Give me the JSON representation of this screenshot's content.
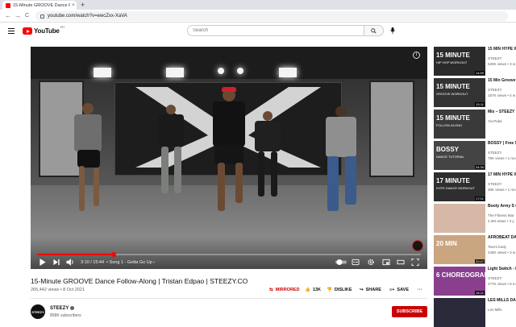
{
  "browser": {
    "tab_title": "15-Minute GROOVE Dance Follo...",
    "tab_close": "×",
    "new_tab": "+",
    "url": "youtube.com/watch?v=ewcZxx-XaVA",
    "back": "←",
    "forward": "→",
    "reload": "C"
  },
  "header": {
    "logo_text": "YouTube",
    "logo_sup": "PH",
    "search_placeholder": "Search"
  },
  "player": {
    "time": "3:10 / 15:44",
    "chapter": "• Song 1 - Gotta Go Up  ›",
    "progress": 0.2
  },
  "video": {
    "title": "15-Minute GROOVE Dance Follow-Along | Tristan Edpao | STEEZY.CO",
    "meta": "265,442 views • 8 Oct 2021",
    "actions": {
      "mirrored": "MIRRORED",
      "likes": "13K",
      "dislike": "DISLIKE",
      "share": "SHARE",
      "save": "SAVE",
      "more": "···"
    }
  },
  "channel": {
    "name": "STEEZY",
    "subscribers": "858K subscribers",
    "avatar_text": "STEEZY",
    "subscribe": "SUBSCRIBE"
  },
  "recommendations": [
    {
      "thumb_title": "15 MINUTE",
      "thumb_sub": "HIP HOP WORKOUT",
      "title": "15 MIN HYPE WORKOUT - F",
      "channel": "STEEZY",
      "views": "540K views • 3 w",
      "duration": "14:59",
      "bg": "#2b2b2b"
    },
    {
      "thumb_title": "15 MINUTE",
      "thumb_sub": "GROOVE WORKOUT",
      "title": "15 Min Groove WORKOUT - F",
      "channel": "STEEZY",
      "views": "157K views • 4 w",
      "duration": "15:11",
      "bg": "#333333"
    },
    {
      "thumb_title": "15 MINUTE",
      "thumb_sub": "FOLLOW-ALONG",
      "title": "Mix – STEEZY",
      "channel": "YouTube",
      "views": "",
      "duration": "",
      "bg": "#3a3a3a"
    },
    {
      "thumb_title": "BOSSY",
      "thumb_sub": "DANCE TUTORIAL",
      "title": "BOSSY | Free S Tutorial | Abey",
      "channel": "STEEZY",
      "views": "79K views • 1 mo",
      "duration": "34:39",
      "bg": "#444444"
    },
    {
      "thumb_title": "17 MINUTE",
      "thumb_sub": "HYPE DANCE WORKOUT",
      "title": "17 MIN HYPE WORKOUT - F",
      "channel": "STEEZY",
      "views": "39K views • 1 mo",
      "duration": "17:01",
      "bg": "#2e2e2e"
    },
    {
      "thumb_title": "",
      "thumb_sub": "",
      "title": "Booty Army S Caleb Marshal",
      "channel": "The Fitness Mar",
      "views": "2.3M views • 3 y",
      "duration": "",
      "bg": "#d7b8a6"
    },
    {
      "thumb_title": "20 MIN",
      "thumb_sub": "",
      "title": "AFROBEAT DA PART 4 | TikTo",
      "channel": "Tara's body",
      "views": "248K views • 3 w",
      "duration": "20:47",
      "bg": "#c9a580"
    },
    {
      "thumb_title": "6 CHOREOGRAPHERS",
      "thumb_sub": "",
      "title": "Light Switch - Dancers Chore",
      "channel": "STEEZY",
      "views": "277K views • 8 m",
      "duration": "18:21",
      "bg": "#8a3f8e"
    },
    {
      "thumb_title": "",
      "thumb_sub": "",
      "title": "LES MILLS DA Vol. 01 | 15-mi",
      "channel": "Les Mills",
      "views": "",
      "duration": "",
      "bg": "#2a2a3a"
    }
  ]
}
